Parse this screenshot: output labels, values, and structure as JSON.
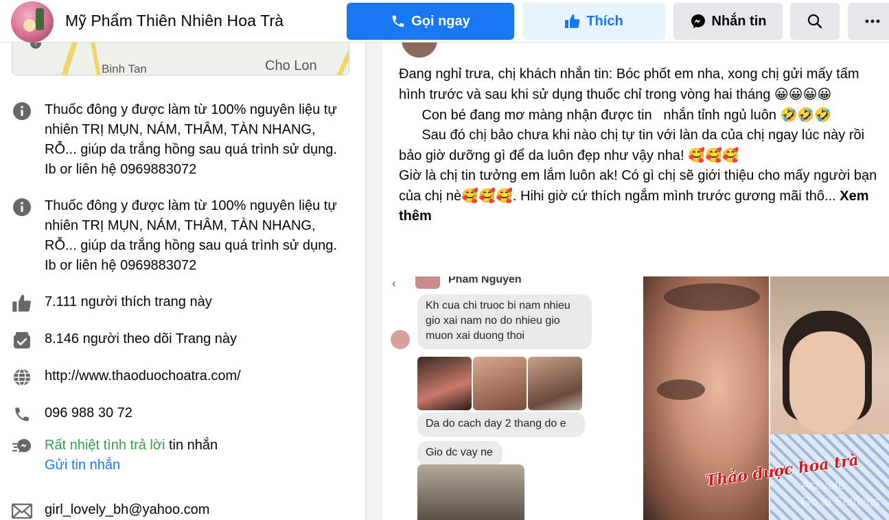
{
  "header": {
    "page_name": "Mỹ Phẩm Thiên Nhiên Hoa Trà",
    "call_label": "Gọi ngay",
    "like_label": "Thích",
    "message_label": "Nhắn tin",
    "accent_color": "#1877f2"
  },
  "map": {
    "label_left": "Binh Tan",
    "label_right": "Cho Lon"
  },
  "intro": {
    "items": [
      {
        "icon": "info-icon",
        "text": "Thuốc đông y được làm từ 100% nguyên liệu tự nhiên TRỊ MỤN, NÁM, THÂM, TÀN NHANG, RỖ... giúp da trắng hồng sau quá trình sử dụng. Ib or liên hệ 0969883072"
      },
      {
        "icon": "info-icon",
        "text": "Thuốc đông y được làm từ 100% nguyên liệu tự nhiên TRỊ MỤN, NÁM, THÂM, TÀN NHANG, RỖ... giúp da trắng hồng sau quá trình sử dụng. Ib or liên hệ 0969883072"
      }
    ],
    "likes": "7.111 người thích trang này",
    "follows": "8.146 người theo dõi Trang này",
    "website": "http://www.thaoduochoatra.com/",
    "phone": "096 988 30 72",
    "responsive_highlight": "Rất nhiệt tình trả lời",
    "responsive_rest": " tin nhắn",
    "send_message": "Gửi tin nhắn",
    "email": "girl_lovely_bh@yahoo.com"
  },
  "post": {
    "line1": "Đang nghỉ trưa, chị khách nhắn tin: Bóc phốt em nha, xong chị gửi mấy tấm hình trước và sau khi sử dụng thuốc chỉ trong vòng hai tháng ",
    "line1_emoji": "😀😀😀😀",
    "line2": "      Con bé đang mơ màng nhận được tin   nhắn tỉnh ngủ luôn ",
    "line2_emoji": "🤣🤣🤣",
    "line3": "      Sau đó chị bảo chưa khi nào chị tự tin với làn da của chị ngay lúc này rồi bảo giờ dưỡng gì để da luôn đẹp như vậy nha! ",
    "line3_emoji": "🥰🥰🥰",
    "line4a": "Giờ là chị tin tưởng em lắm luôn ak! Có gì chị sẽ giới thiệu cho mấy người bạn của chị nè",
    "line4_emoji": "🥰🥰🥰",
    "line4b": ". Hihi giờ cứ thích ngắm mình trước gương mãi thô... ",
    "see_more": "Xem thêm"
  },
  "chat": {
    "contact_name": "Pham Nguyen",
    "msg1": "Kh cua chi truoc bi nam nhieu gio xai nam no do nhieu gio muon xai duong thoi",
    "msg2": "Da do cach day 2 thang do e",
    "msg3": "Gio dc vay ne"
  },
  "photo": {
    "watermark": "Thảo dược hoa trà",
    "activate_line1": "Activate",
    "activate_line2": "Go to Settings"
  }
}
